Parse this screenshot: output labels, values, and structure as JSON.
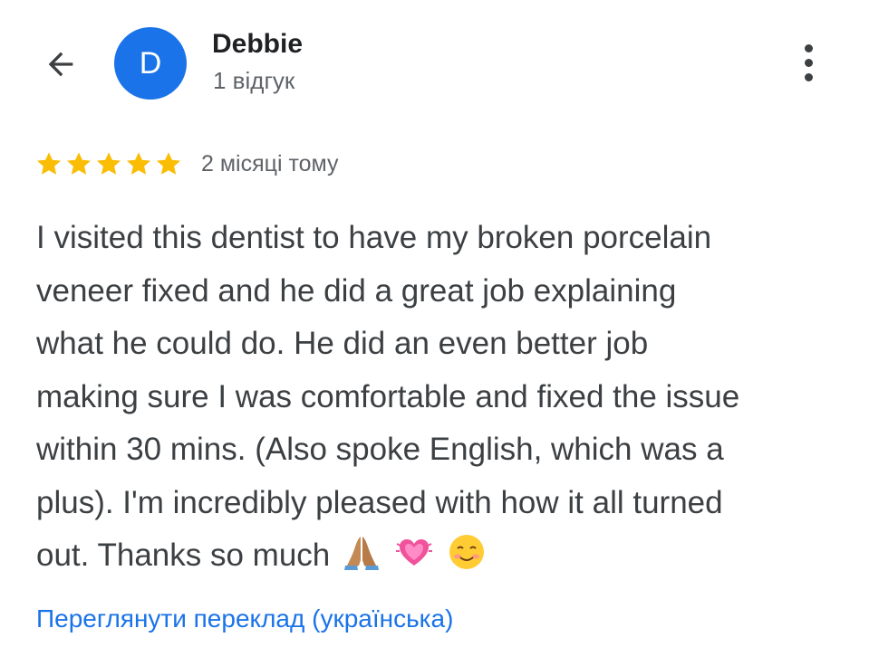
{
  "header": {
    "back_icon": "arrow-left-icon",
    "avatar_letter": "D",
    "avatar_color": "#1a73e8",
    "reviewer_name": "Debbie",
    "review_count": "1 відгук",
    "more_icon": "more-vertical-icon"
  },
  "review": {
    "rating": 5,
    "max_rating": 5,
    "star_color": "#fbbc04",
    "star_icon": "star-icon",
    "date": "2 місяці тому",
    "lines": [
      "I visited this dentist to have my broken porcelain",
      "veneer fixed and he did a great job explaining",
      "what he could do. He did an even better job",
      "making sure I was comfortable and fixed the issue",
      "within 30 mins. (Also spoke English, which was a",
      "plus). I'm incredibly pleased with how it all turned",
      "out. Thanks so much"
    ],
    "emojis": [
      "folded-hands-emoji",
      "beating-heart-emoji",
      "smiling-face-emoji"
    ]
  },
  "translate_link": "Переглянути переклад (українська)",
  "colors": {
    "link": "#1a73e8",
    "text": "#3c4043",
    "secondary": "#5f6368"
  }
}
